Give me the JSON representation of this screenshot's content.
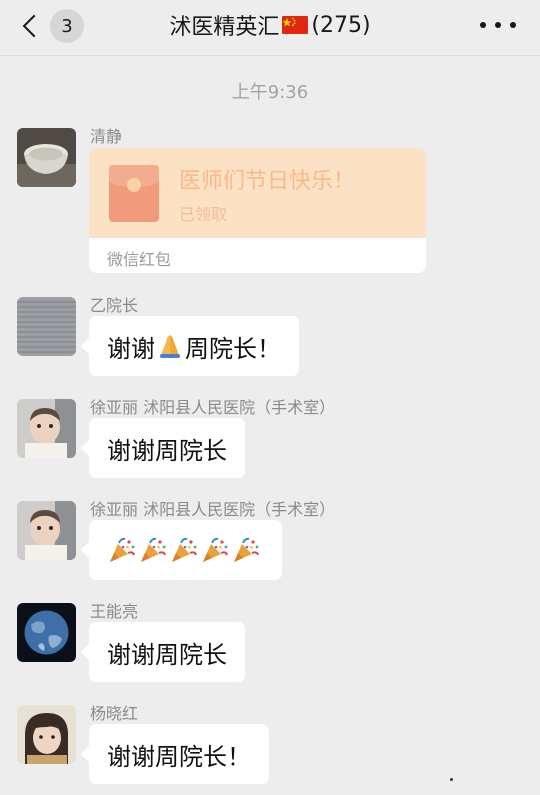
{
  "header": {
    "unread_count": "3",
    "title_name": "沭医精英汇",
    "title_count": "(275)"
  },
  "timestamp": "上午9:36",
  "messages": [
    {
      "sender": "清静",
      "type": "red_packet",
      "red_packet": {
        "title": "医师们节日快乐！",
        "status": "已领取",
        "label": "微信红包"
      }
    },
    {
      "sender": "乙院长",
      "text_before": "谢谢",
      "emoji": "folded-hands",
      "text_after": "周院长！"
    },
    {
      "sender": "徐亚丽 沭阳县人民医院（手术室）",
      "text": "谢谢周院长"
    },
    {
      "sender": "徐亚丽 沭阳县人民医院（手术室）",
      "emoji": "party-popper",
      "emoji_count": 5
    },
    {
      "sender": "王能亮",
      "text": "谢谢周院长"
    },
    {
      "sender": "杨晓红",
      "text": "谢谢周院长！"
    }
  ],
  "colors": {
    "background": "#ededed",
    "bubble": "#ffffff",
    "red_packet_top": "#fbe2c4",
    "red_packet_text": "#fdb889",
    "timestamp": "#a3a3a3"
  }
}
